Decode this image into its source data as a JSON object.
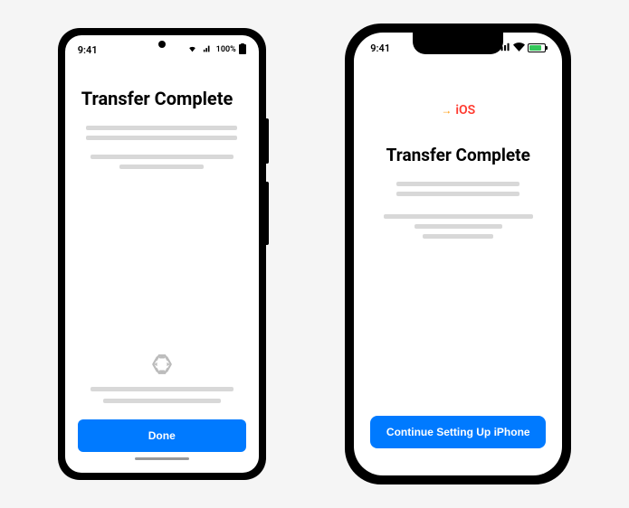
{
  "android": {
    "status": {
      "time": "9:41",
      "battery": "100%"
    },
    "title": "Transfer Complete",
    "button_label": "Done"
  },
  "iphone": {
    "status": {
      "time": "9:41"
    },
    "logo_text": "iOS",
    "title": "Transfer Complete",
    "button_label": "Continue Setting Up iPhone"
  },
  "colors": {
    "primary": "#007aff",
    "ios_logo": "#ff3b30"
  }
}
